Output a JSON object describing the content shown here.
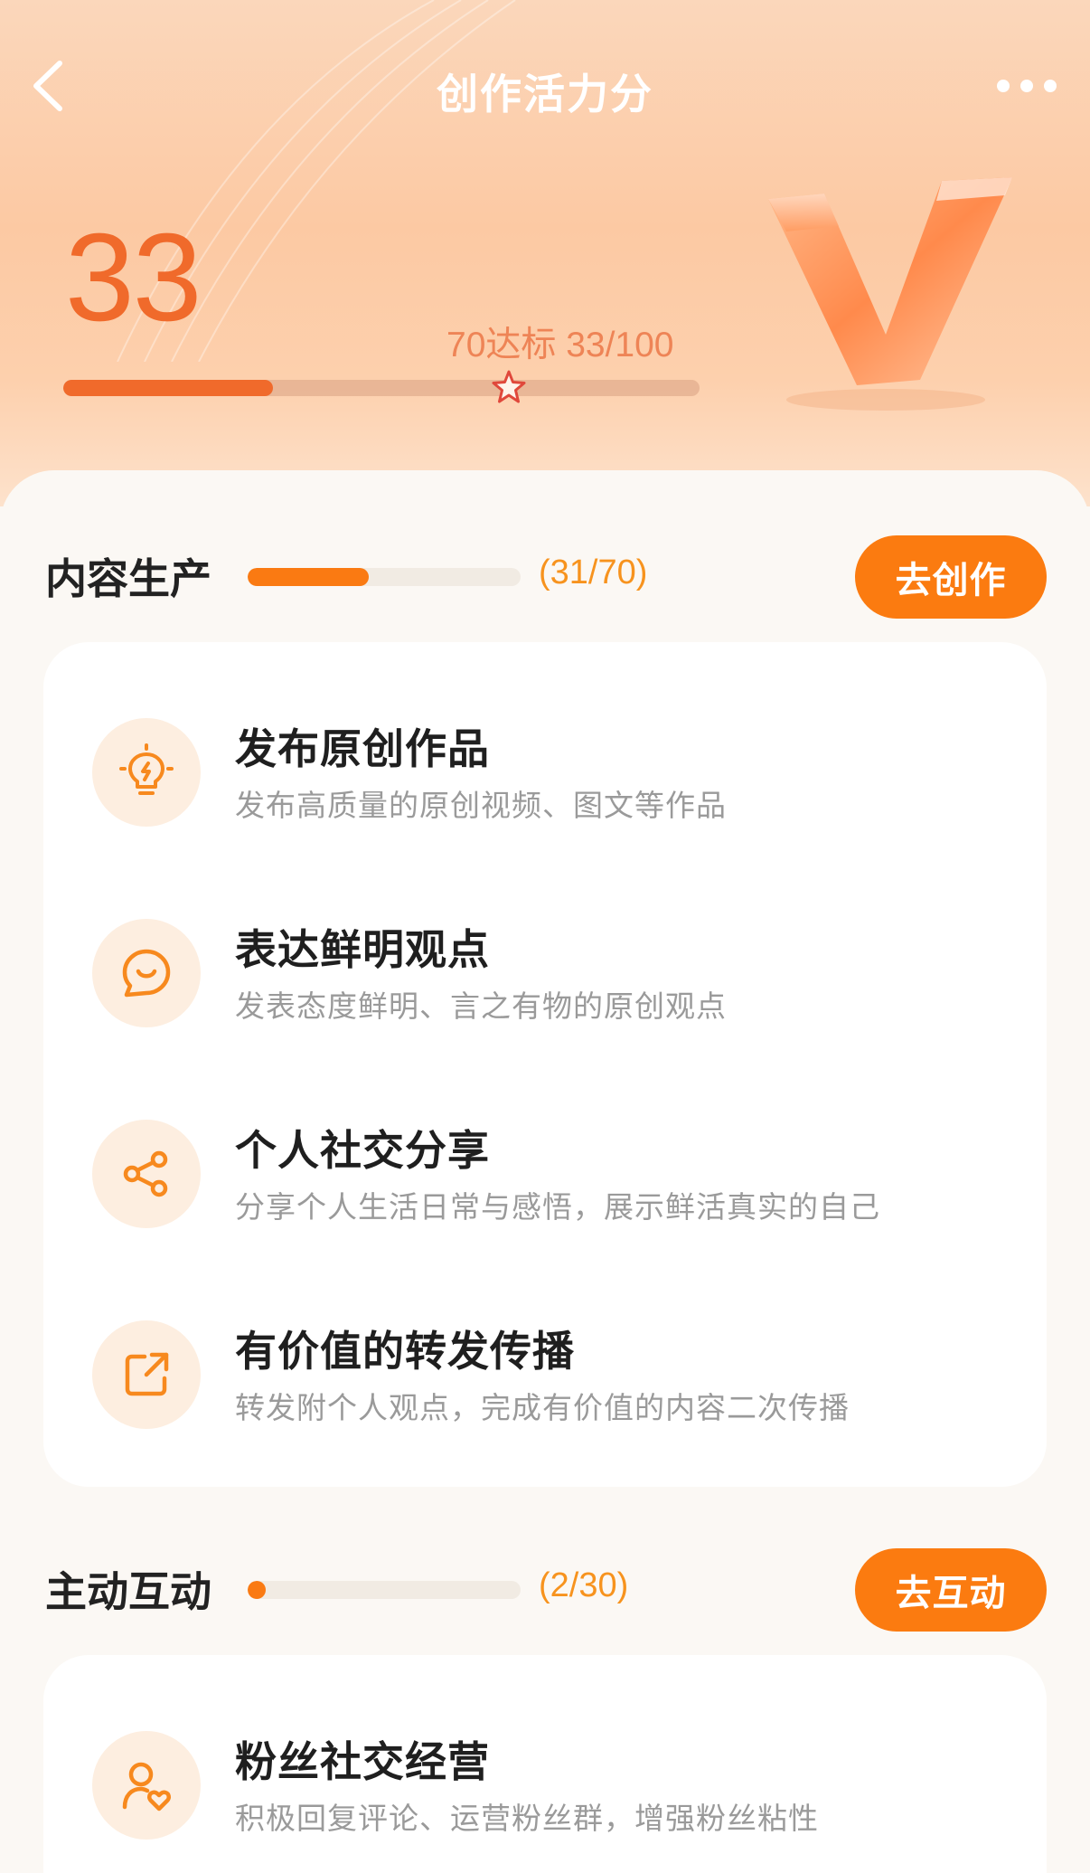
{
  "header": {
    "title": "创作活力分"
  },
  "score": {
    "value": "33",
    "goal_text": "70达标 33/100",
    "progress": 0.33,
    "target": 0.7
  },
  "colors": {
    "accent": "#fb7b10",
    "score": "#f06a2b",
    "count": "#f7931e"
  },
  "sections": [
    {
      "title": "内容生产",
      "count": "(31/70)",
      "progress": 0.443,
      "button": "去创作",
      "items": [
        {
          "icon": "lightbulb-icon",
          "title": "发布原创作品",
          "desc": "发布高质量的原创视频、图文等作品"
        },
        {
          "icon": "smile-chat-icon",
          "title": "表达鲜明观点",
          "desc": "发表态度鲜明、言之有物的原创观点"
        },
        {
          "icon": "share-icon",
          "title": "个人社交分享",
          "desc": "分享个人生活日常与感悟，展示鲜活真实的自己"
        },
        {
          "icon": "forward-icon",
          "title": "有价值的转发传播",
          "desc": "转发附个人观点，完成有价值的内容二次传播"
        }
      ]
    },
    {
      "title": "主动互动",
      "count": "(2/30)",
      "progress": 0.067,
      "button": "去互动",
      "items": [
        {
          "icon": "fan-heart-icon",
          "title": "粉丝社交经营",
          "desc": "积极回复评论、运营粉丝群，增强粉丝粘性"
        }
      ]
    }
  ]
}
